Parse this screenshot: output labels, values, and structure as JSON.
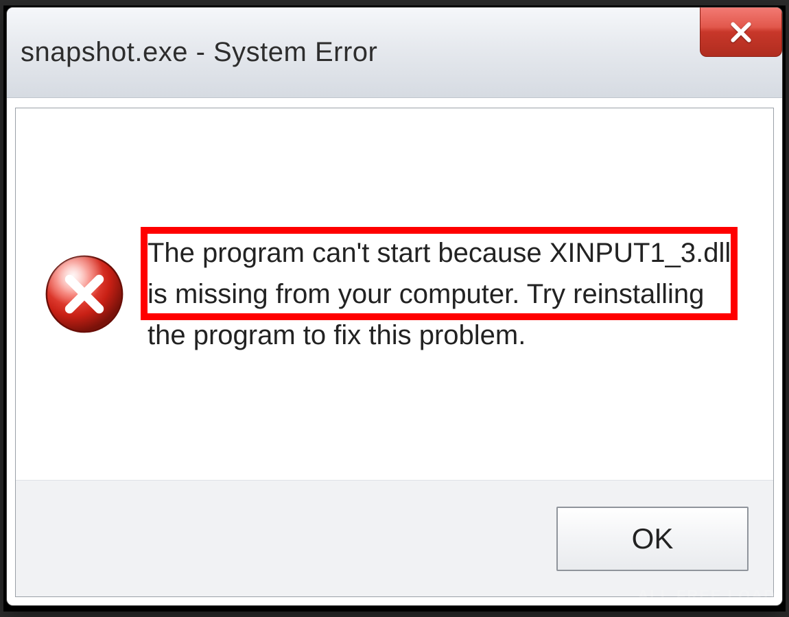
{
  "titlebar": {
    "title": "snapshot.exe - System Error",
    "close_tooltip": "Close"
  },
  "icons": {
    "error": "error-icon",
    "close": "close-icon"
  },
  "message": {
    "text": "The program can't start because XINPUT1_3.dll is missing from your computer. Try reinstalling the program to fix this problem.",
    "highlighted_fragment": "XINPUT1_3.dll is missing"
  },
  "buttons": {
    "ok_label": "OK"
  },
  "annotation": {
    "highlight_color": "#ff0000"
  },
  "watermark": "ALL FREE LOAD"
}
